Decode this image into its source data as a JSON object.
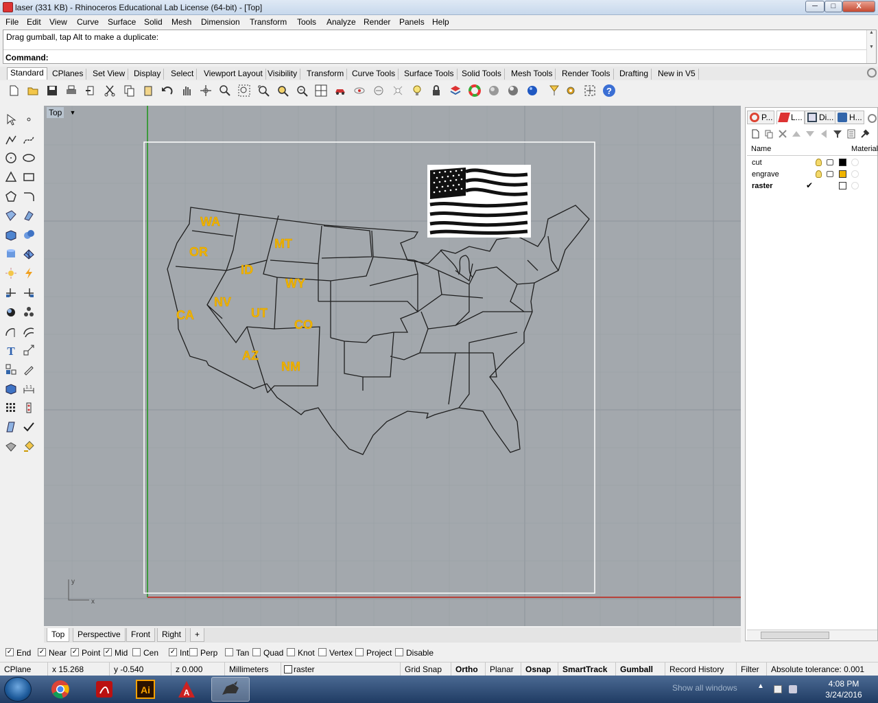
{
  "window": {
    "title": "laser (331 KB) - Rhinoceros Educational Lab License (64-bit) - [Top]",
    "minimize": "─",
    "maximize": "□",
    "close": "X"
  },
  "menu": [
    "File",
    "Edit",
    "View",
    "Curve",
    "Surface",
    "Solid",
    "Mesh",
    "Dimension",
    "Transform",
    "Tools",
    "Analyze",
    "Render",
    "Panels",
    "Help"
  ],
  "command": {
    "history": "Drag gumball, tap Alt to make a duplicate:",
    "label": "Command:",
    "value": ""
  },
  "toolbar_tabs": [
    "Standard",
    "CPlanes",
    "Set View",
    "Display",
    "Select",
    "Viewport Layout",
    "Visibility",
    "Transform",
    "Curve Tools",
    "Surface Tools",
    "Solid Tools",
    "Mesh Tools",
    "Render Tools",
    "Drafting",
    "New in V5"
  ],
  "toolbar_icons": [
    "new-file-icon",
    "open-icon",
    "save-icon",
    "print-icon",
    "import-icon",
    "cut-icon",
    "copy-icon",
    "paste-icon",
    "undo-icon",
    "pan-icon",
    "rotate-view-icon",
    "zoom-icon",
    "zoom-window-icon",
    "zoom-extents-icon",
    "zoom-selected-icon",
    "viewport-layout-icon",
    "car-icon",
    "hide-icon",
    "show-icon",
    "lock-light-icon",
    "lightbulb-icon",
    "lock-icon",
    "layer-icon",
    "color-wheel-icon",
    "shaded-sphere-icon",
    "render-sphere-icon",
    "blue-sphere-icon",
    "lamp-icon",
    "options-icon",
    "gumball-icon",
    "help-icon"
  ],
  "viewport": {
    "name": "Top",
    "dropdown": "▼",
    "axis_x": "x",
    "axis_y": "y",
    "state_labels": [
      "WA",
      "OR",
      "CA",
      "ID",
      "NV",
      "MT",
      "WY",
      "UT",
      "CO",
      "AZ",
      "NM"
    ]
  },
  "viewport_tabs": [
    "Top",
    "Perspective",
    "Front",
    "Right",
    "+"
  ],
  "panel": {
    "tabs": [
      "P...",
      "L...",
      "Di...",
      "H..."
    ],
    "header_name": "Name",
    "header_material": "Material",
    "layers": [
      {
        "name": "cut",
        "color": "#000000",
        "current": false
      },
      {
        "name": "engrave",
        "color": "#f0b400",
        "current": false
      },
      {
        "name": "raster",
        "color": "#ffffff",
        "current": true
      }
    ]
  },
  "osnaps": [
    {
      "label": "End",
      "checked": true
    },
    {
      "label": "Near",
      "checked": true
    },
    {
      "label": "Point",
      "checked": true
    },
    {
      "label": "Mid",
      "checked": true
    },
    {
      "label": "Cen",
      "checked": false
    },
    {
      "label": "Int",
      "checked": true
    },
    {
      "label": "Perp",
      "checked": false
    },
    {
      "label": "Tan",
      "checked": false
    },
    {
      "label": "Quad",
      "checked": false
    },
    {
      "label": "Knot",
      "checked": false
    },
    {
      "label": "Vertex",
      "checked": false
    },
    {
      "label": "Project",
      "checked": false
    },
    {
      "label": "Disable",
      "checked": false
    }
  ],
  "status": {
    "cplane": "CPlane",
    "x": "x 15.268",
    "y": "y -0.540",
    "z": "z 0.000",
    "units": "Millimeters",
    "layer": "raster",
    "grid_snap": "Grid Snap",
    "ortho": "Ortho",
    "planar": "Planar",
    "osnap": "Osnap",
    "smarttrack": "SmartTrack",
    "gumball": "Gumball",
    "record_history": "Record History",
    "filter": "Filter",
    "tolerance": "Absolute tolerance: 0.001"
  },
  "taskbar": {
    "time": "4:08 PM",
    "date": "3/24/2016",
    "show_desktop": "Show all windows",
    "tray_up": "▲",
    "apps": [
      "chrome",
      "pdf",
      "illustrator",
      "autocad",
      "rhino"
    ]
  },
  "colors": {
    "engrave": "#f0b400",
    "viewport_bg": "#a3a8ad",
    "x_axis": "#b8423a",
    "y_axis": "#3d9a3d"
  }
}
